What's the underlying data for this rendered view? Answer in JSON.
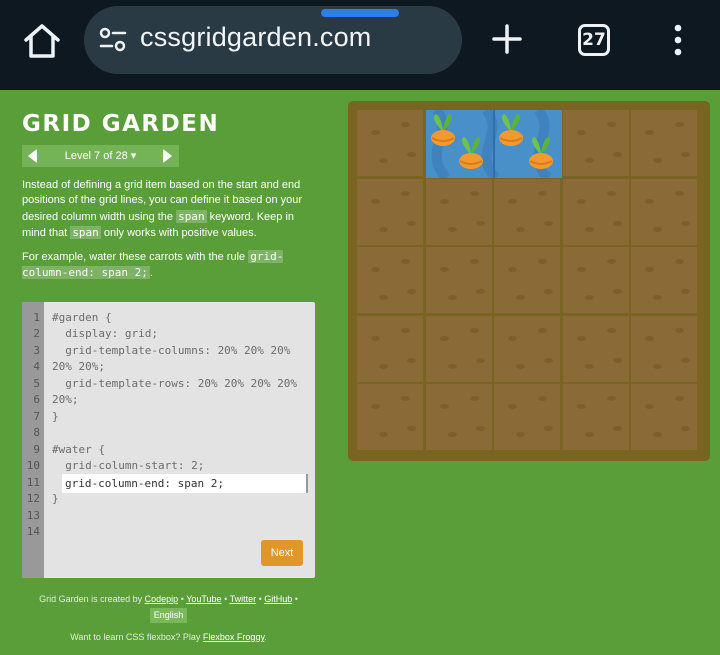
{
  "browser": {
    "url": "cssgridgarden.com",
    "tab_count": "27",
    "icons": {
      "home": "home-icon",
      "site_settings": "tune-icon",
      "new_tab": "plus-icon",
      "menu": "more-vert-icon"
    }
  },
  "game": {
    "title": "GRID GARDEN",
    "level_label": "Level 7 of 28 ▾",
    "instructions": {
      "p1_before_span": "Instead of defining a grid item based on the start and end positions of the grid lines, you can define it based on your desired column width using the ",
      "p1_span_code": "span",
      "p1_middle": " keyword. Keep in mind that ",
      "p1_span_code2": "span",
      "p1_after": " only works with positive values.",
      "p2_before": "For example, water these carrots with the rule ",
      "p2_code": "grid-column-end: span 2;",
      "p2_after": "."
    },
    "editor": {
      "line_numbers": [
        "1",
        "2",
        "3",
        "4",
        "5",
        "6",
        "7",
        "8",
        "9",
        "10",
        "11",
        "12",
        "13",
        "14"
      ],
      "lines": [
        "#garden {",
        "  display: grid;",
        "  grid-template-columns: 20% 20% 20%",
        "20% 20%;",
        "  grid-template-rows: 20% 20% 20% 20%",
        "20%;",
        "}",
        "",
        "#water {",
        "  grid-column-start: 2;",
        "",
        "}",
        "",
        ""
      ],
      "input_value": "grid-column-end: span 2;",
      "next_label": "Next"
    },
    "footer": {
      "created_by": "Grid Garden is created by ",
      "codepip": "Codepip",
      "sep": " • ",
      "youtube": "YouTube",
      "twitter": "Twitter",
      "github": "GitHub",
      "language": "English",
      "flexbox_prefix": "Want to learn CSS flexbox? Play ",
      "flexbox_link": "Flexbox Froggy"
    },
    "colors": {
      "background": "#5a9e3a",
      "soil": "#8a6a36",
      "water": "#4a90c8",
      "next_button": "#e0962a"
    }
  }
}
